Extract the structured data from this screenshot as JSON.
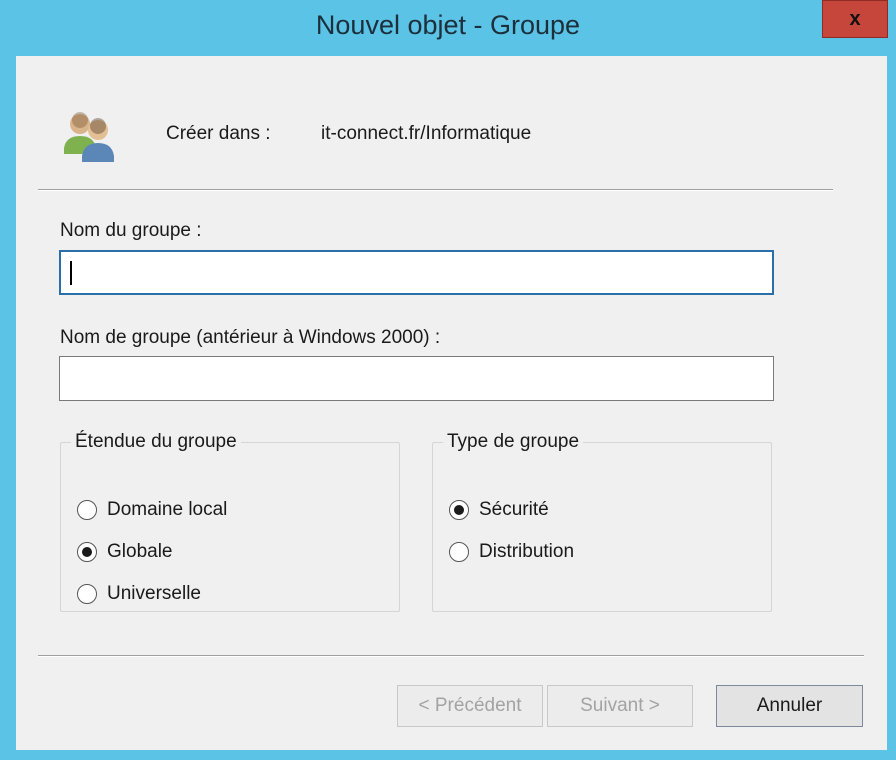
{
  "window": {
    "title": "Nouvel objet - Groupe",
    "close_label": "x"
  },
  "header": {
    "icon": "group-users-icon",
    "create_in_label": "Créer dans :",
    "create_in_value": "it-connect.fr/Informatique"
  },
  "form": {
    "group_name_label": "Nom du groupe :",
    "group_name_value": "",
    "group_name_pre2000_label": "Nom de groupe (antérieur à Windows 2000) :",
    "group_name_pre2000_value": ""
  },
  "scope": {
    "legend": "Étendue du groupe",
    "options": [
      {
        "label": "Domaine local",
        "selected": false
      },
      {
        "label": "Globale",
        "selected": true
      },
      {
        "label": "Universelle",
        "selected": false
      }
    ]
  },
  "type": {
    "legend": "Type de groupe",
    "options": [
      {
        "label": "Sécurité",
        "selected": true
      },
      {
        "label": "Distribution",
        "selected": false
      }
    ]
  },
  "buttons": {
    "previous": "< Précédent",
    "next": "Suivant >",
    "cancel": "Annuler"
  },
  "colors": {
    "frame": "#5bc3e6",
    "close": "#c7463b",
    "focus_border": "#2a6fa8"
  }
}
